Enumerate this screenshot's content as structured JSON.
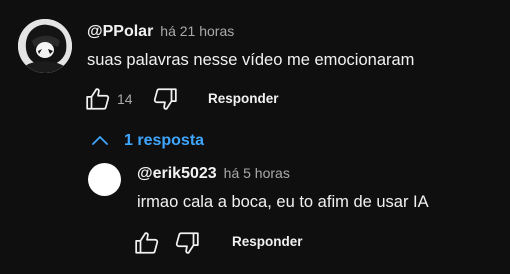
{
  "comment": {
    "author": "@PPolar",
    "time": "há 21 horas",
    "text": "suas palavras nesse vídeo me emocionaram",
    "likes": "14",
    "reply_label": "Responder"
  },
  "replies_toggle": {
    "label": "1 resposta",
    "icon": "chevron-up-icon"
  },
  "reply": {
    "author": "@erik5023",
    "time": "há 5 horas",
    "text": "irmao cala a boca, eu to afim de usar IA",
    "reply_label": "Responder"
  },
  "colors": {
    "background": "#0f0f0f",
    "text": "#f1f1f1",
    "muted": "#aaaaaa",
    "link": "#3ea6ff"
  }
}
